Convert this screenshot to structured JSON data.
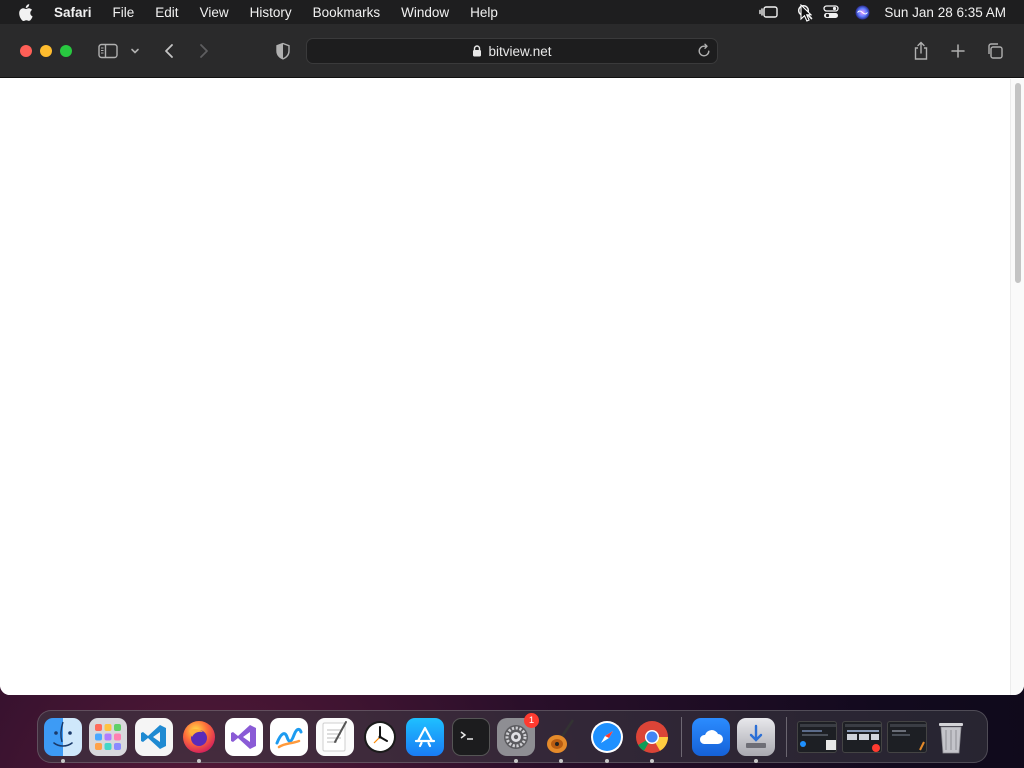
{
  "menubar": {
    "app_name": "Safari",
    "items": [
      "File",
      "Edit",
      "View",
      "History",
      "Bookmarks",
      "Window",
      "Help"
    ],
    "clock": "Sun Jan 28  6:35 AM"
  },
  "browser": {
    "url": "bitview.net"
  },
  "dock": {
    "apps": [
      {
        "icon": "finder-icon",
        "running": true
      },
      {
        "icon": "launchpad-icon",
        "running": false
      },
      {
        "icon": "vscode-icon",
        "running": false
      },
      {
        "icon": "firefox-icon",
        "running": true
      },
      {
        "icon": "visual-studio-icon",
        "running": false
      },
      {
        "icon": "freeform-icon",
        "running": false
      },
      {
        "icon": "textedit-icon",
        "running": false
      },
      {
        "icon": "clock-icon",
        "running": false
      },
      {
        "icon": "app-store-icon",
        "running": false
      },
      {
        "icon": "terminal-icon",
        "running": false
      },
      {
        "icon": "system-settings-icon",
        "running": true,
        "badge": "1"
      },
      {
        "icon": "garageband-icon",
        "running": true
      },
      {
        "icon": "safari-icon",
        "running": true
      },
      {
        "icon": "chrome-icon",
        "running": true
      }
    ],
    "extras": [
      {
        "icon": "weather-icon",
        "running": false
      },
      {
        "icon": "installer-icon",
        "running": true
      }
    ]
  },
  "colors": {
    "menubar": "#1e1e1f",
    "toolbar": "#2a2a2b",
    "close": "#fe5f57",
    "minimize": "#febc2e",
    "maximize": "#28c840",
    "badge": "#ff3b30"
  }
}
